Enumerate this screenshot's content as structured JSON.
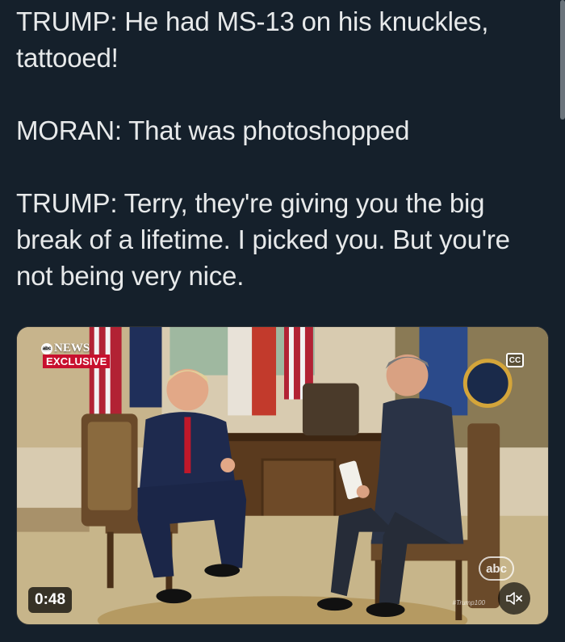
{
  "tweet": {
    "paragraphs": [
      "TRUMP: He had MS-13 on his knuckles, tattooed!",
      "MORAN: That was photoshopped",
      "TRUMP: Terry, they're giving you the big break of a lifetime. I picked you. But you're not being very nice."
    ]
  },
  "video": {
    "network_logo": "NEWS",
    "network_badge": "abc",
    "exclusive_label": "EXCLUSIVE",
    "cc_label": "CC",
    "duration": "0:48",
    "watermark_logo": "abc",
    "hashtag": "#Trump100",
    "mute_icon": "speaker-muted-icon"
  },
  "colors": {
    "background": "#15202b",
    "text": "#e7e9ea",
    "exclusive_red": "#c8102e"
  }
}
